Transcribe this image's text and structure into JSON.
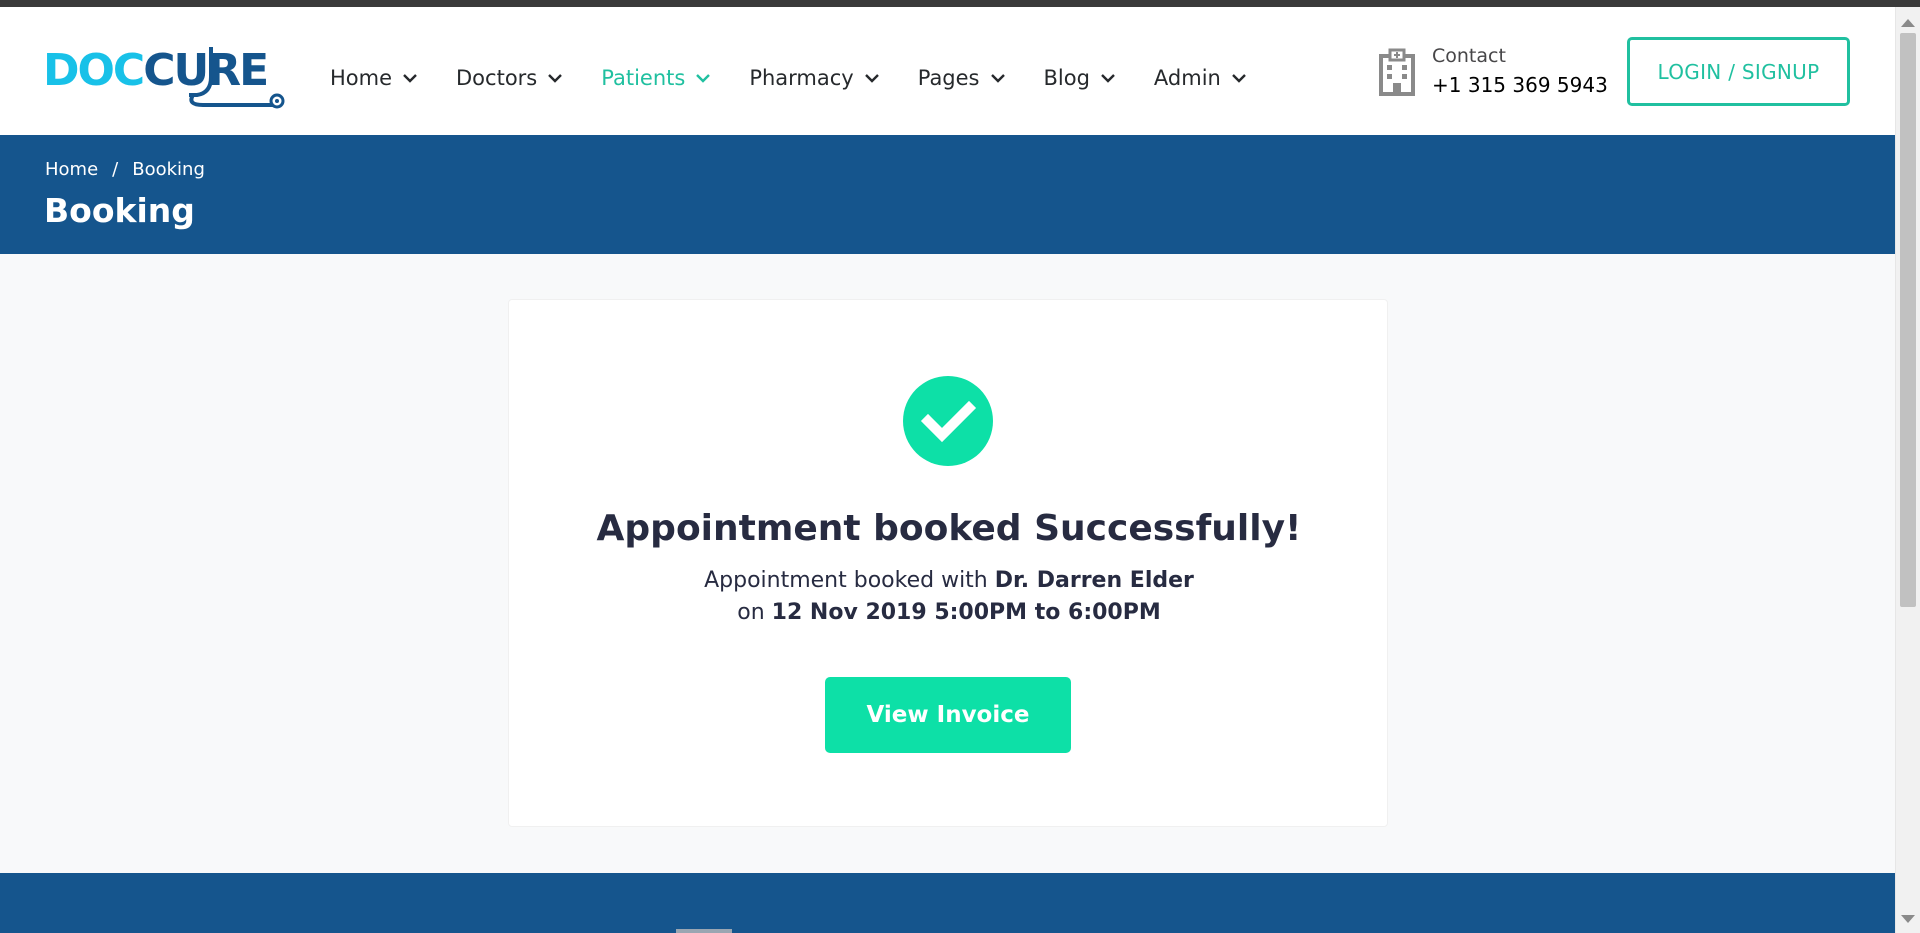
{
  "logo": {
    "text": "DOCCURE"
  },
  "nav": {
    "items": [
      {
        "label": "Home",
        "active": false
      },
      {
        "label": "Doctors",
        "active": false
      },
      {
        "label": "Patients",
        "active": true
      },
      {
        "label": "Pharmacy",
        "active": false
      },
      {
        "label": "Pages",
        "active": false
      },
      {
        "label": "Blog",
        "active": false
      },
      {
        "label": "Admin",
        "active": false
      }
    ]
  },
  "contact": {
    "label": "Contact",
    "phone": "+1 315 369 5943"
  },
  "login_label": "LOGIN / SIGNUP",
  "breadcrumb": {
    "home": "Home",
    "separator": "/",
    "current": "Booking"
  },
  "page_title": "Booking",
  "success": {
    "title": "Appointment booked Successfully!",
    "line1_prefix": "Appointment booked with ",
    "doctor": "Dr. Darren Elder",
    "line2_prefix": "on ",
    "datetime": "12 Nov 2019 5:00PM to 6:00PM",
    "button": "View Invoice"
  },
  "colors": {
    "primary": "#15558d",
    "accent": "#20c0a0",
    "success": "#0de0a7",
    "text": "#272b41"
  },
  "icons": {
    "chevron": "chevron-down-icon",
    "hospital": "hospital-icon",
    "check": "check-icon"
  }
}
